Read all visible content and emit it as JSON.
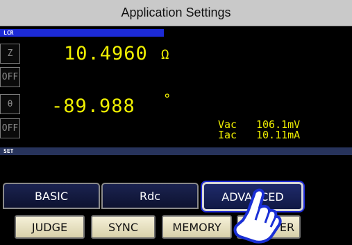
{
  "window": {
    "title": "Application Settings"
  },
  "lcr": {
    "section_label": "LCR",
    "rows": [
      {
        "param": "Z",
        "value": "10.4960",
        "unit": "Ω"
      },
      {
        "param": "θ",
        "value": "-89.988",
        "unit": "°"
      }
    ],
    "off_buttons": [
      "OFF",
      "OFF"
    ],
    "monitor": [
      {
        "label": "Vac",
        "value": "106.1mV"
      },
      {
        "label": "Iac",
        "value": "10.11mA"
      }
    ]
  },
  "set": {
    "section_label": "SET",
    "tabs": [
      {
        "label": "BASIC",
        "active": false
      },
      {
        "label": "Rdc",
        "active": false
      },
      {
        "label": "ADVANCED",
        "active": true
      }
    ],
    "buttons": [
      "JUDGE",
      "SYNC",
      "MEMORY",
      "LEVOVER"
    ]
  },
  "colors": {
    "measurement_text": "#f0f000",
    "section_bar": "#1c2ad6",
    "panel_bg": "#000000",
    "menu_button_bg": "#efe8c8"
  },
  "icons": {
    "pointer": "pointing-hand-icon"
  }
}
